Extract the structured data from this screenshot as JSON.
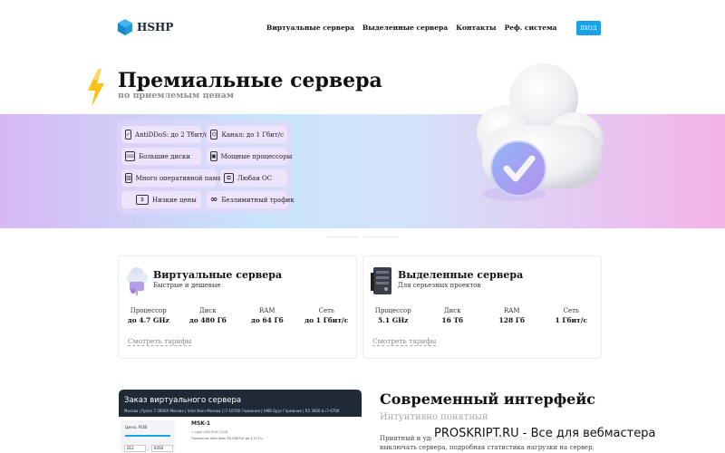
{
  "header": {
    "logo_text": "HSHP",
    "nav": [
      "Виртуальные сервера",
      "Выделенные сервера",
      "Контакты",
      "Реф. система"
    ],
    "login_label": "ВХОД"
  },
  "hero": {
    "title": "Премиальные сервера",
    "subtitle": "по приемлемым ценам",
    "features": [
      {
        "icon": "shield-check-icon",
        "glyph": "✓",
        "label": "AntiDDoS: до 2 Тбит/с"
      },
      {
        "icon": "network-icon",
        "glyph": "⌬",
        "label": "Канал: до 1 Гбит/с"
      },
      {
        "icon": "ssd-icon",
        "glyph": "SSD",
        "label": "Большие диски"
      },
      {
        "icon": "cpu-icon",
        "glyph": "▣",
        "label": "Мощные процессоры"
      },
      {
        "icon": "ram-icon",
        "glyph": "▥",
        "label": "Много оперативной памяти"
      },
      {
        "icon": "os-icon",
        "glyph": "⧉",
        "label": "Любая ОС"
      },
      {
        "icon": "price-icon",
        "glyph": "$",
        "label": "Низкие цены"
      },
      {
        "icon": "infinity-icon",
        "glyph": "∞",
        "label": "Безлимитный трафик"
      }
    ]
  },
  "cards": [
    {
      "title": "Виртуальные сервера",
      "subtitle": "Быстрые и дешевые",
      "icon": "cloud-servers-icon",
      "specs": [
        {
          "label": "Процессор",
          "value": "до 4.7 GHz"
        },
        {
          "label": "Диск",
          "value": "до 480 Гб"
        },
        {
          "label": "RAM",
          "value": "до 64 Гб"
        },
        {
          "label": "Сеть",
          "value": "до 1 Гбит/с"
        }
      ],
      "link": "Смотреть тарифы"
    },
    {
      "title": "Выделенные сервера",
      "subtitle": "Для серьезных проектов",
      "icon": "server-rack-icon",
      "specs": [
        {
          "label": "Процессор",
          "value": "5.1 GHz"
        },
        {
          "label": "Диск",
          "value": "16 Тб"
        },
        {
          "label": "RAM",
          "value": "128 Гб"
        },
        {
          "label": "Сеть",
          "value": "1 Гбит/с"
        }
      ],
      "link": "Смотреть тарифы"
    }
  ],
  "order_preview": {
    "title": "Заказ виртуального сервера",
    "tabs": "Москва | Ryzen 7 5800X   Москва | Intel Xeon   Москва | i7-10700   Германия | AMD Epyc   Германия | R5 3600 & i7-6700",
    "price_label": "Цена, RUB",
    "min": "212",
    "max": "6350",
    "plan": "MSK-1",
    "plan_specs": "1 ядро     2GB RAM     15GB",
    "plan_cpu": "Процессор Intel Xeon E5-2667v2 до 4.0 ГГц"
  },
  "modern": {
    "title": "Современный интерфейс",
    "subtitle": "Интуитивно понятный",
    "text": "Приятный и удобный онлайн кабинет. Легко включать и выключать сервера, подробная статистика нагрузки на сервер, множество способов"
  },
  "watermark": "PROSKRIPT.RU - Все для вебмастера",
  "colors": {
    "accent": "#1ba1ea",
    "dark": "#1f2a36"
  }
}
